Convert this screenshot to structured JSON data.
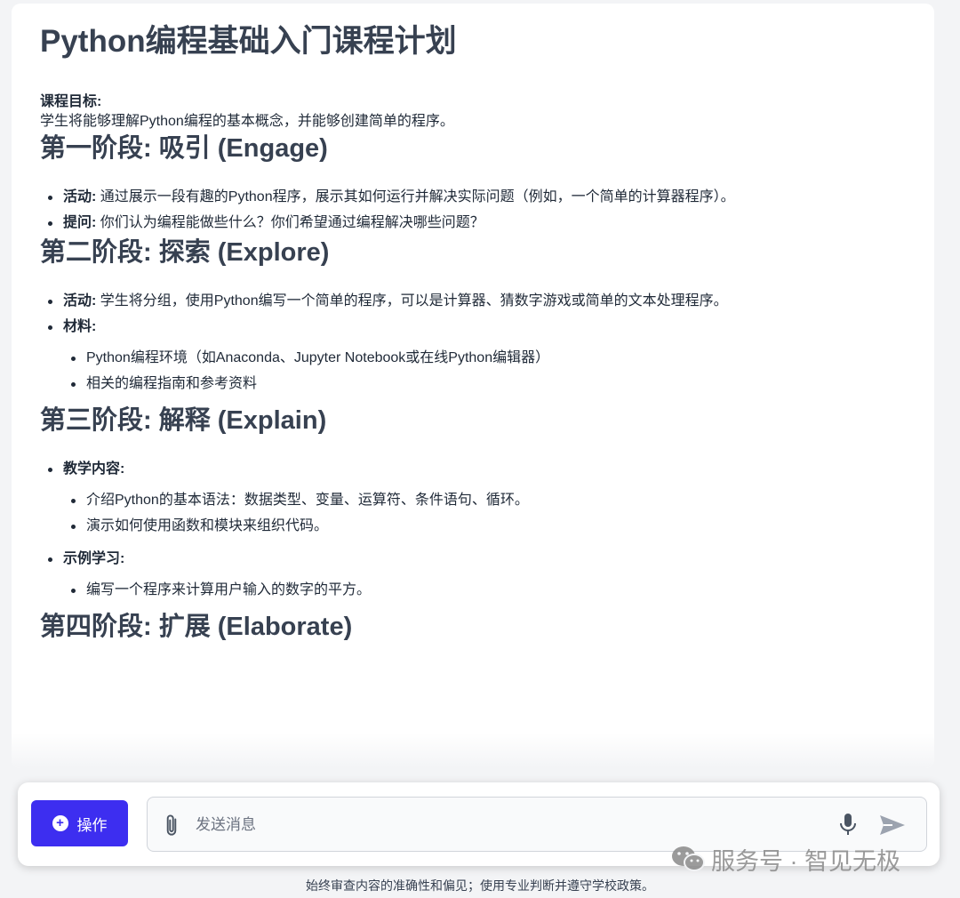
{
  "document": {
    "title": "Python编程基础入门课程计划",
    "goal_label": "课程目标:",
    "goal_text": "学生将能够理解Python编程的基本概念，并能够创建简单的程序。",
    "stages": [
      {
        "heading": "第一阶段: 吸引 (Engage)",
        "items": [
          {
            "label": "活动:",
            "text": " 通过展示一段有趣的Python程序，展示其如何运行并解决实际问题（例如，一个简单的计算器程序）。"
          },
          {
            "label": "提问:",
            "text": " 你们认为编程能做些什么？你们希望通过编程解决哪些问题？"
          }
        ]
      },
      {
        "heading": "第二阶段: 探索 (Explore)",
        "items": [
          {
            "label": "活动:",
            "text": " 学生将分组，使用Python编写一个简单的程序，可以是计算器、猜数字游戏或简单的文本处理程序。"
          },
          {
            "label": "材料:",
            "text": "",
            "sub": [
              "Python编程环境（如Anaconda、Jupyter Notebook或在线Python编辑器）",
              "相关的编程指南和参考资料"
            ]
          }
        ]
      },
      {
        "heading": "第三阶段: 解释 (Explain)",
        "items": [
          {
            "label": "教学内容:",
            "text": "",
            "sub": [
              "介绍Python的基本语法：数据类型、变量、运算符、条件语句、循环。",
              "演示如何使用函数和模块来组织代码。"
            ]
          },
          {
            "label": "示例学习:",
            "text": "",
            "sub": [
              "编写一个程序来计算用户输入的数字的平方。"
            ]
          }
        ]
      },
      {
        "heading": "第四阶段: 扩展 (Elaborate)"
      }
    ]
  },
  "composer": {
    "action_label": "操作",
    "message_placeholder": "发送消息"
  },
  "watermark": "服务号 · 智见无极",
  "disclaimer": "始终审查内容的准确性和偏见；使用专业判断并遵守学校政策。",
  "icons": [
    "plus-circle-icon",
    "paperclip-icon",
    "microphone-icon",
    "send-icon",
    "wechat-icon"
  ],
  "colors": {
    "accent": "#3d2ef0",
    "heading": "#374151"
  }
}
